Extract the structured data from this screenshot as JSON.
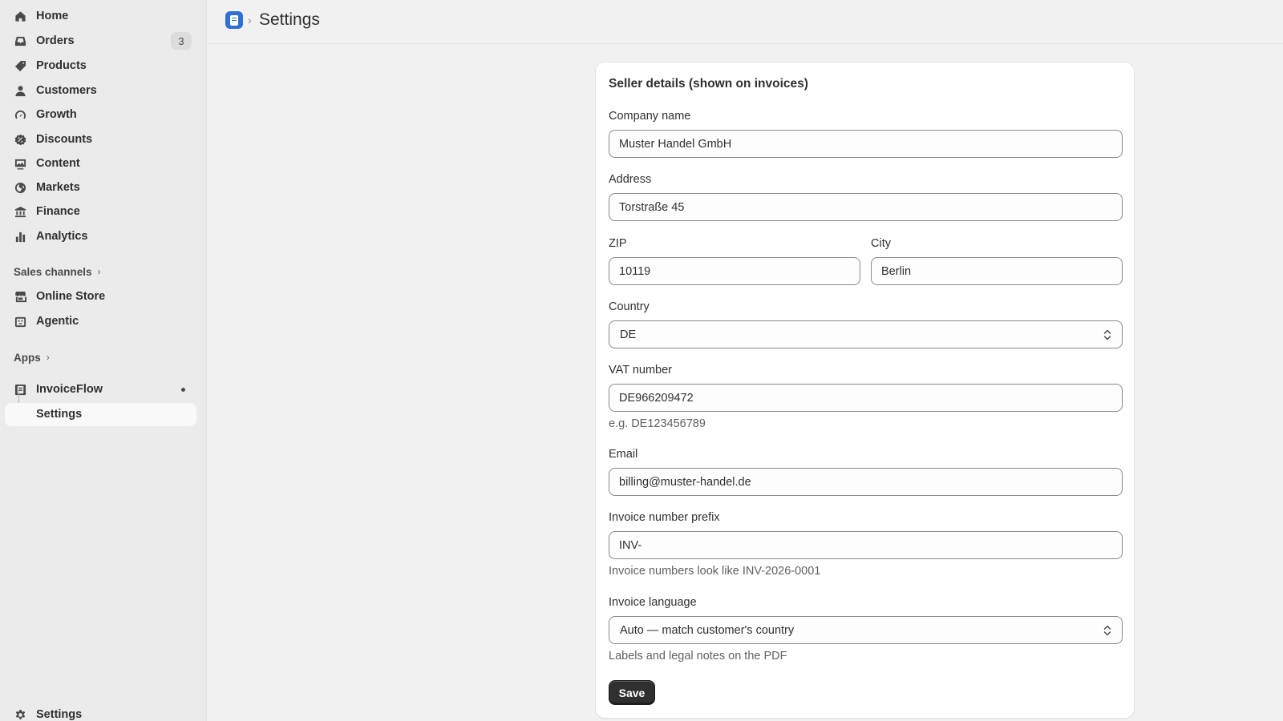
{
  "sidebar": {
    "items": [
      {
        "label": "Home",
        "icon": "home-icon"
      },
      {
        "label": "Orders",
        "icon": "inbox-icon",
        "badge": "3"
      },
      {
        "label": "Products",
        "icon": "tag-icon"
      },
      {
        "label": "Customers",
        "icon": "person-icon"
      },
      {
        "label": "Growth",
        "icon": "gauge-icon"
      },
      {
        "label": "Discounts",
        "icon": "discount-icon"
      },
      {
        "label": "Content",
        "icon": "image-icon"
      },
      {
        "label": "Markets",
        "icon": "globe-icon"
      },
      {
        "label": "Finance",
        "icon": "bank-icon"
      },
      {
        "label": "Analytics",
        "icon": "bar-chart-icon"
      }
    ],
    "sales_channels_label": "Sales channels",
    "channels": [
      {
        "label": "Online Store",
        "icon": "store-icon"
      },
      {
        "label": "Agentic",
        "icon": "robot-icon"
      }
    ],
    "apps_label": "Apps",
    "app": {
      "label": "InvoiceFlow",
      "icon": "invoice-app-icon"
    },
    "app_sub": {
      "label": "Settings"
    },
    "bottom_settings": {
      "label": "Settings",
      "icon": "gear-icon"
    }
  },
  "header": {
    "separator": "›",
    "title": "Settings"
  },
  "form": {
    "title": "Seller details (shown on invoices)",
    "company_label": "Company name",
    "company_value": "Muster Handel GmbH",
    "address_label": "Address",
    "address_value": "Torstraße 45",
    "zip_label": "ZIP",
    "zip_value": "10119",
    "city_label": "City",
    "city_value": "Berlin",
    "country_label": "Country",
    "country_value": "DE",
    "vat_label": "VAT number",
    "vat_value": "DE966209472",
    "vat_help": "e.g. DE123456789",
    "email_label": "Email",
    "email_value": "billing@muster-handel.de",
    "prefix_label": "Invoice number prefix",
    "prefix_value": "INV-",
    "prefix_help": "Invoice numbers look like INV-2026-0001",
    "language_label": "Invoice language",
    "language_value": "Auto — match customer's country",
    "language_help": "Labels and legal notes on the PDF",
    "save_label": "Save"
  },
  "colors": {
    "background": "#f1f1f1",
    "sidebar": "#ebebeb",
    "card": "#ffffff",
    "primary_button": "#303030",
    "app_logo": "#2f6fd6"
  }
}
